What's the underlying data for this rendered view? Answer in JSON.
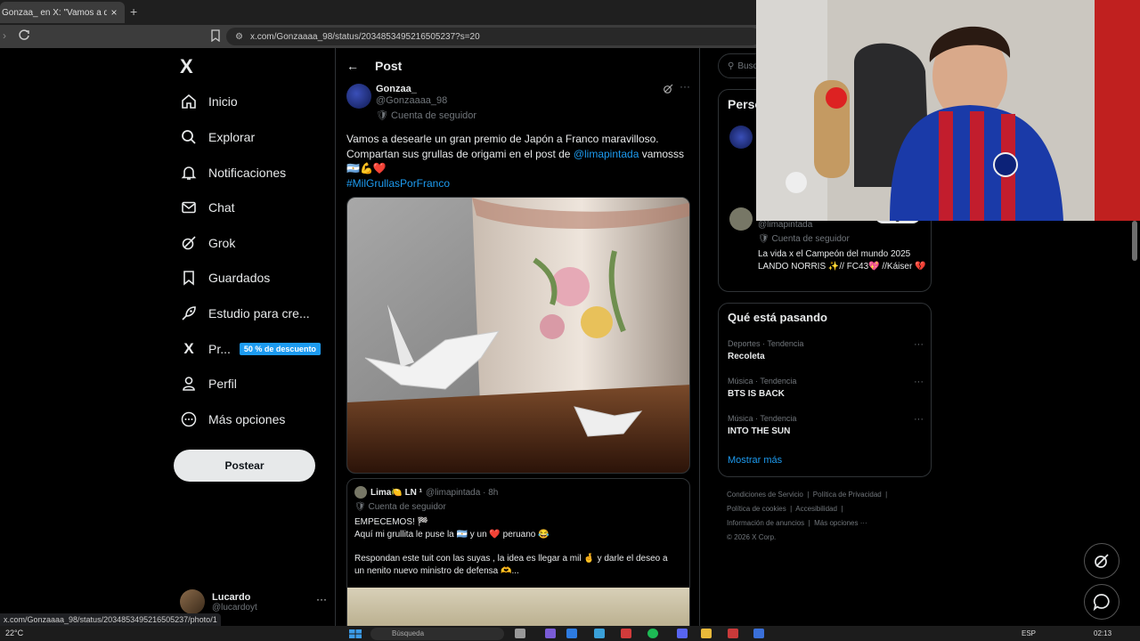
{
  "browser": {
    "tab_title": "Gonzaa_ en X: \"Vamos a desearle",
    "tab_close": "×",
    "new_tab": "+",
    "url": "x.com/Gonzaaaa_98/status/2034853495216505237?s=20",
    "status_url": "x.com/Gonzaaaa_98/status/2034853495216505237/photo/1"
  },
  "nav": {
    "logo": "X",
    "items": [
      {
        "label": "Inicio",
        "icon": "home-icon"
      },
      {
        "label": "Explorar",
        "icon": "search-icon"
      },
      {
        "label": "Notificaciones",
        "icon": "bell-icon"
      },
      {
        "label": "Chat",
        "icon": "mail-icon"
      },
      {
        "label": "Grok",
        "icon": "grok-icon"
      },
      {
        "label": "Guardados",
        "icon": "bookmark-icon"
      },
      {
        "label": "Estudio para cre...",
        "icon": "rocket-icon"
      },
      {
        "label": "Pr...",
        "icon": "x-premium-icon"
      },
      {
        "label": "Perfil",
        "icon": "person-icon"
      },
      {
        "label": "Más opciones",
        "icon": "more-circle-icon"
      }
    ],
    "premium_badge": "50 % de descuento",
    "post_button": "Postear",
    "account": {
      "name": "Lucardo",
      "handle": "@lucardoyt",
      "more": "···"
    }
  },
  "main": {
    "title": "Post",
    "author": {
      "name": "Gonzaa_",
      "handle": "@Gonzaaaa_98",
      "subscriber": "Cuenta de seguidor"
    },
    "more": "···",
    "text_line1": "Vamos a desearle un gran premio de Japón a Franco maravilloso.",
    "text_line2a": "Compartan sus grullas de origami en el post de ",
    "mention": "@limapintada",
    "text_line2b": " vamosss",
    "emojis": "🇦🇷💪❤️",
    "hashtag": "#MilGrullasPorFranco",
    "quote": {
      "name": "Lima🍋 LN ¹",
      "handle": "@limapintada · 8h",
      "subscriber": "Cuenta de seguidor",
      "line1": "EMPECEMOS! 🏁",
      "line2": "Aquí mi grullita le puse la 🇦🇷 y un ❤️ peruano 😂",
      "line3": "Respondan este tuit con las suyas , la idea es llegar a mil 🤞 y darle el deseo a",
      "line4": "un nenito nuevo ministro de defensa 🫶..."
    }
  },
  "right": {
    "search_placeholder": "Busc",
    "persons_title": "Perso",
    "follow": "Seguir",
    "p2": {
      "handle": "@limapintada",
      "subscriber": "Cuenta de seguidor",
      "bio": "La vida x el Campeón del mundo 2025 LANDO NORRIS ✨// FC43💖 //Káiser 💔"
    },
    "trends_title": "Qué está pasando",
    "trends": [
      {
        "meta": "Deportes · Tendencia",
        "name": "Recoleta"
      },
      {
        "meta": "Música · Tendencia",
        "name": "BTS IS BACK"
      },
      {
        "meta": "Música · Tendencia",
        "name": "INTO THE SUN"
      }
    ],
    "show_more": "Mostrar más",
    "footer": {
      "l1": "Condiciones de Servicio",
      "l2": "Política de Privacidad",
      "l3": "Política de cookies",
      "l4": "Accesibilidad",
      "l5": "Información de anuncios",
      "l6": "Más opciones ···",
      "l7": "© 2026 X Corp."
    }
  },
  "taskbar": {
    "weather": "22°C",
    "search": "Búsqueda",
    "lang": "ESP",
    "time": "02:13"
  },
  "colors": {
    "accent": "#1d9bf0",
    "background": "#000000",
    "border": "#2f3336",
    "muted": "#71767b"
  }
}
